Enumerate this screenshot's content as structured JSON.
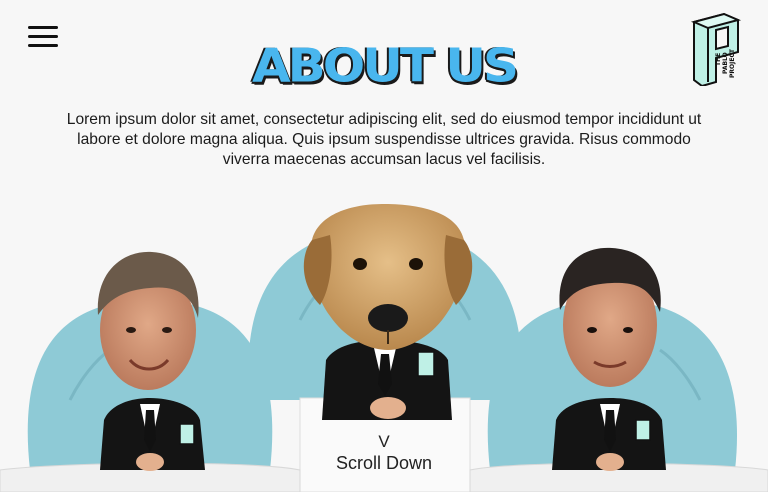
{
  "header": {
    "menu_icon": "hamburger-menu-icon",
    "logo_text": "THE PABLO PROJECT"
  },
  "hero": {
    "title": "ABOUT US",
    "intro": "Lorem ipsum dolor sit amet, consectetur adipiscing elit, sed do eiusmod tempor incididunt ut labore et dolore magna aliqua. Quis ipsum suspendisse ultrices gravida. Risus commodo viverra maecenas accumsan lacus vel facilisis."
  },
  "team": {
    "members": [
      "man-left",
      "dog-center",
      "man-right"
    ],
    "chair_color": "#8ecad6",
    "suit_color": "#141414"
  },
  "scroll": {
    "arrow": "V",
    "label": "Scroll Down"
  },
  "colors": {
    "title_blue": "#49b6ee",
    "logo_teal": "#bff0e6"
  }
}
